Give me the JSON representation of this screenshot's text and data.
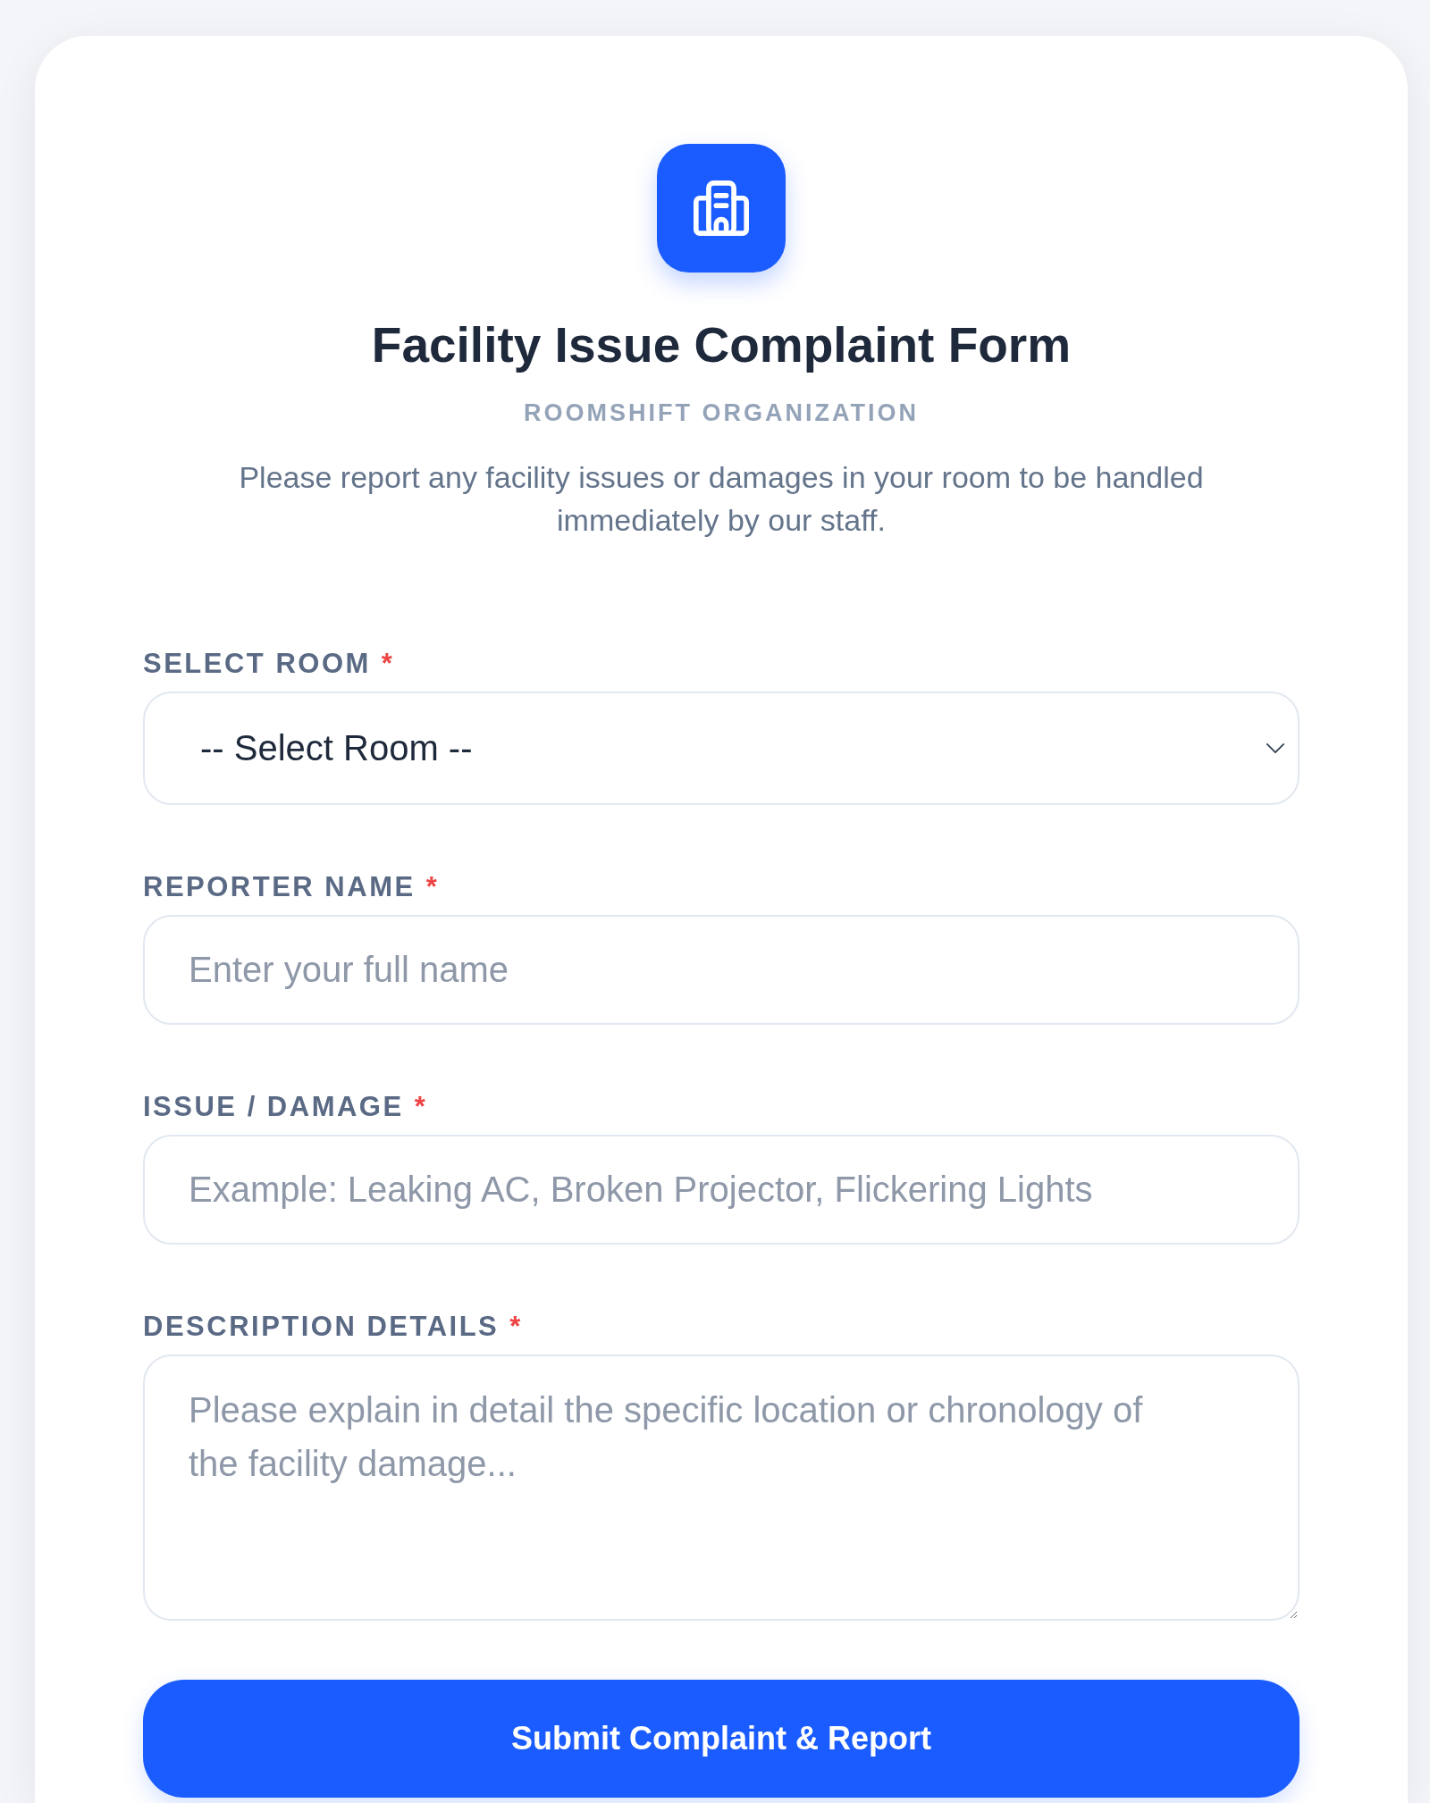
{
  "header": {
    "title": "Facility Issue Complaint Form",
    "organization": "ROOMSHIFT ORGANIZATION",
    "description": "Please report any facility issues or damages in your room to be handled immediately by our staff."
  },
  "fields": [
    {
      "kind": "select",
      "label": "SELECT ROOM",
      "required_mark": "*",
      "value": "-- Select Room --"
    },
    {
      "kind": "text",
      "label": "REPORTER NAME",
      "required_mark": "*",
      "placeholder": "Enter your full name"
    },
    {
      "kind": "text",
      "label": "ISSUE / DAMAGE",
      "required_mark": "*",
      "placeholder": "Example: Leaking AC, Broken Projector, Flickering Lights"
    },
    {
      "kind": "textarea",
      "label": "DESCRIPTION DETAILS",
      "required_mark": "*",
      "placeholder": "Please explain in detail the specific location or chronology of the facility damage..."
    }
  ],
  "submit_button": {
    "label": "Submit Complaint & Report"
  }
}
